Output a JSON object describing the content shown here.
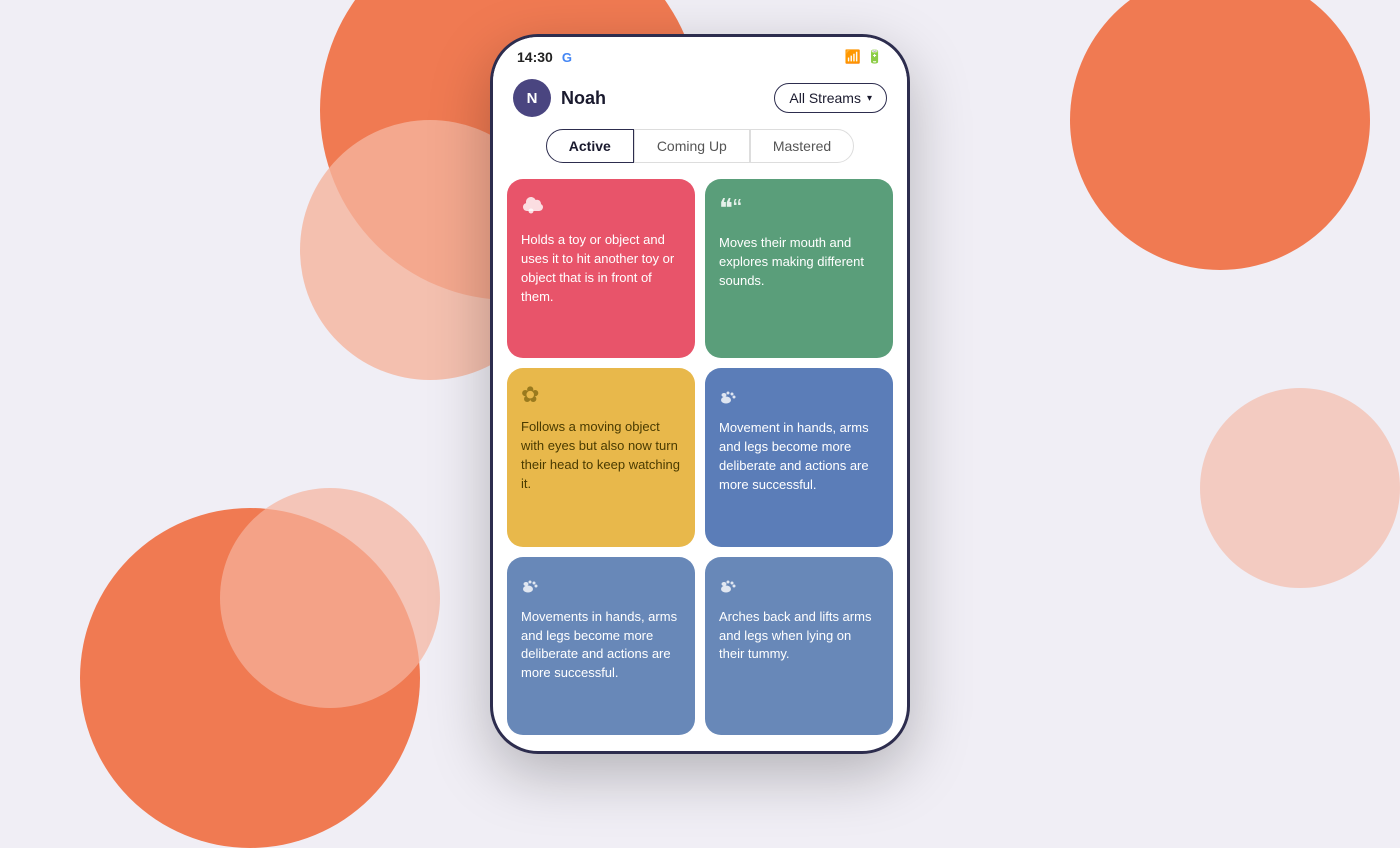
{
  "background": {
    "color": "#f0eef5"
  },
  "status_bar": {
    "time": "14:30",
    "google_label": "G",
    "wifi_icon": "wifi-icon",
    "battery_icon": "battery-icon"
  },
  "header": {
    "avatar_letter": "N",
    "user_name": "Noah",
    "streams_button_label": "All Streams",
    "streams_chevron": "▾"
  },
  "tabs": [
    {
      "label": "Active",
      "active": true
    },
    {
      "label": "Coming Up",
      "active": false
    },
    {
      "label": "Mastered",
      "active": false
    }
  ],
  "cards": [
    {
      "color": "card-red",
      "icon_type": "cloud",
      "text": "Holds a toy or object and uses it to hit another toy or object that is in front of them."
    },
    {
      "color": "card-green",
      "icon_type": "quote",
      "text": "Moves their mouth and explores making different sounds."
    },
    {
      "color": "card-yellow",
      "icon_type": "flower",
      "text": "Follows a moving object with eyes but also now turn their head to keep watching it."
    },
    {
      "color": "card-blue",
      "icon_type": "foot",
      "text": "Movement in hands, arms and legs become more deliberate and actions are more successful."
    },
    {
      "color": "card-blue-2",
      "icon_type": "foot",
      "text": "Movements in hands, arms and legs become more deliberate and actions are more successful."
    },
    {
      "color": "card-blue-3",
      "icon_type": "foot",
      "text": "Arches back and lifts arms and legs when lying on their tummy."
    }
  ]
}
